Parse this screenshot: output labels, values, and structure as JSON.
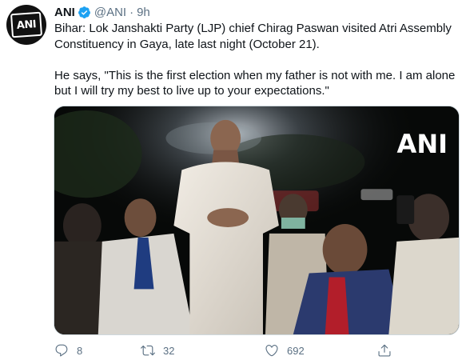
{
  "tweet": {
    "author_name": "ANI",
    "author_handle": "@ANI",
    "separator": "·",
    "time": "9h",
    "avatar_text": "ANI",
    "text": "Bihar: Lok Janshakti Party (LJP) chief Chirag Paswan visited Atri Assembly\nConstituency in Gaya, late last night (October 21).\n\nHe says, \"This is the first election when my father is not with me. I am alone\nbut I will try my best to live up to your expectations.\"",
    "media": {
      "watermark": "ANI"
    },
    "actions": {
      "reply_count": "8",
      "retweet_count": "32",
      "like_count": "692"
    },
    "colors": {
      "verified": "#1da1f2",
      "muted": "#5b7083"
    },
    "icons": [
      "verified-badge-icon",
      "reply-icon",
      "retweet-icon",
      "like-icon",
      "share-icon"
    ]
  }
}
